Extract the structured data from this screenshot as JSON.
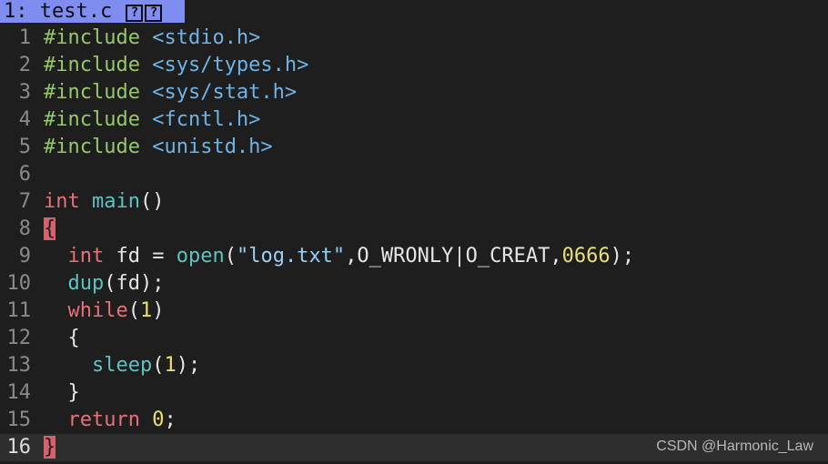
{
  "tab": {
    "label": "1: test.c",
    "icons": [
      "?",
      "?"
    ]
  },
  "code_lines": [
    {
      "num": "1",
      "tokens": [
        {
          "t": "#include",
          "c": "pp"
        },
        {
          "t": " ",
          "c": "plain"
        },
        {
          "t": "<stdio.h>",
          "c": "inc"
        }
      ]
    },
    {
      "num": "2",
      "tokens": [
        {
          "t": "#include",
          "c": "pp"
        },
        {
          "t": " ",
          "c": "plain"
        },
        {
          "t": "<sys/types.h>",
          "c": "inc"
        }
      ]
    },
    {
      "num": "3",
      "tokens": [
        {
          "t": "#include",
          "c": "pp"
        },
        {
          "t": " ",
          "c": "plain"
        },
        {
          "t": "<sys/stat.h>",
          "c": "inc"
        }
      ]
    },
    {
      "num": "4",
      "tokens": [
        {
          "t": "#include",
          "c": "pp"
        },
        {
          "t": " ",
          "c": "plain"
        },
        {
          "t": "<fcntl.h>",
          "c": "inc"
        }
      ]
    },
    {
      "num": "5",
      "tokens": [
        {
          "t": "#include",
          "c": "pp"
        },
        {
          "t": " ",
          "c": "plain"
        },
        {
          "t": "<unistd.h>",
          "c": "inc"
        }
      ]
    },
    {
      "num": "6",
      "tokens": []
    },
    {
      "num": "7",
      "tokens": [
        {
          "t": "int",
          "c": "kw"
        },
        {
          "t": " ",
          "c": "plain"
        },
        {
          "t": "main",
          "c": "fn"
        },
        {
          "t": "()",
          "c": "plain"
        }
      ]
    },
    {
      "num": "8",
      "tokens": [
        {
          "t": "{",
          "c": "brace-hl"
        }
      ]
    },
    {
      "num": "9",
      "tokens": [
        {
          "t": "  ",
          "c": "plain"
        },
        {
          "t": "int",
          "c": "kw"
        },
        {
          "t": " fd = ",
          "c": "plain"
        },
        {
          "t": "open",
          "c": "fn"
        },
        {
          "t": "(",
          "c": "plain"
        },
        {
          "t": "\"log.txt\"",
          "c": "str"
        },
        {
          "t": ",O_WRONLY|O_CREAT,",
          "c": "plain"
        },
        {
          "t": "0666",
          "c": "num"
        },
        {
          "t": ");",
          "c": "plain"
        }
      ]
    },
    {
      "num": "10",
      "tokens": [
        {
          "t": "  ",
          "c": "plain"
        },
        {
          "t": "dup",
          "c": "fn"
        },
        {
          "t": "(fd);",
          "c": "plain"
        }
      ]
    },
    {
      "num": "11",
      "tokens": [
        {
          "t": "  ",
          "c": "plain"
        },
        {
          "t": "while",
          "c": "kw"
        },
        {
          "t": "(",
          "c": "plain"
        },
        {
          "t": "1",
          "c": "num"
        },
        {
          "t": ")",
          "c": "plain"
        }
      ]
    },
    {
      "num": "12",
      "tokens": [
        {
          "t": "  {",
          "c": "plain"
        }
      ]
    },
    {
      "num": "13",
      "tokens": [
        {
          "t": "    ",
          "c": "plain"
        },
        {
          "t": "sleep",
          "c": "fn"
        },
        {
          "t": "(",
          "c": "plain"
        },
        {
          "t": "1",
          "c": "num"
        },
        {
          "t": ");",
          "c": "plain"
        }
      ]
    },
    {
      "num": "14",
      "tokens": [
        {
          "t": "  }",
          "c": "plain"
        }
      ]
    },
    {
      "num": "15",
      "tokens": [
        {
          "t": "  ",
          "c": "plain"
        },
        {
          "t": "return",
          "c": "kw"
        },
        {
          "t": " ",
          "c": "plain"
        },
        {
          "t": "0",
          "c": "num"
        },
        {
          "t": ";",
          "c": "plain"
        }
      ]
    },
    {
      "num": "16",
      "tokens": [
        {
          "t": "}",
          "c": "brace-hl"
        }
      ],
      "current": true
    }
  ],
  "watermark": "CSDN @Harmonic_Law",
  "colors": {
    "background": "#1e1e1e",
    "tab_active": "#7f8cf0",
    "preprocessor": "#97c76a",
    "include_path": "#6fb3e6",
    "keyword": "#e8707a",
    "function": "#5cc3c0",
    "string": "#9ad0f5",
    "number": "#e8e071",
    "matching_brace": "#d9616e"
  }
}
